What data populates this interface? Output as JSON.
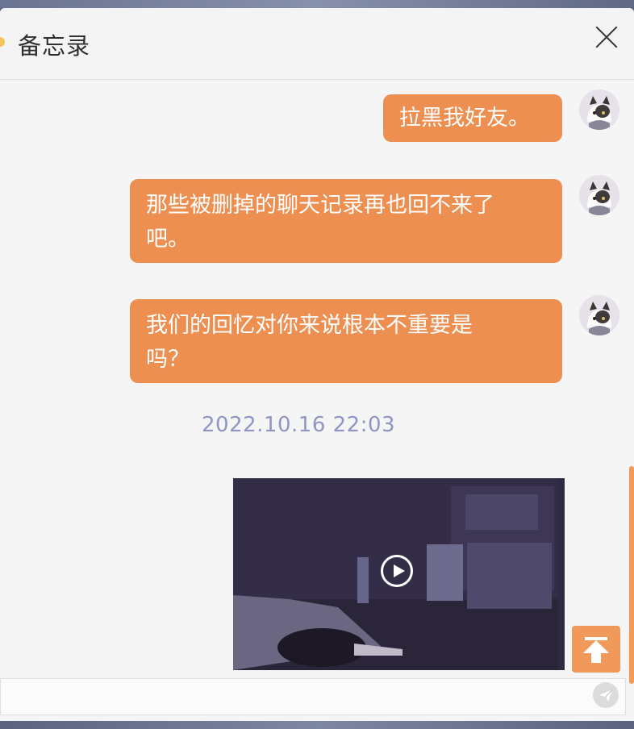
{
  "header": {
    "title": "备忘录"
  },
  "messages": [
    {
      "text": "拉黑我好友。"
    },
    {
      "line1": "那些被删掉的聊天记录再也回不来了",
      "line2": "吧。"
    },
    {
      "line1": "我们的回忆对你来说根本不重要是",
      "line2": "吗？"
    }
  ],
  "timestamp": "2022.10.16    22:03",
  "video": {
    "play_icon": "play-icon"
  },
  "icons": {
    "close": "close-icon",
    "send": "send-icon",
    "top": "arrow-up-icon"
  },
  "colors": {
    "bubble": "#ee8f52",
    "timestamp": "#8f96c4",
    "top_button": "#f0995a"
  }
}
